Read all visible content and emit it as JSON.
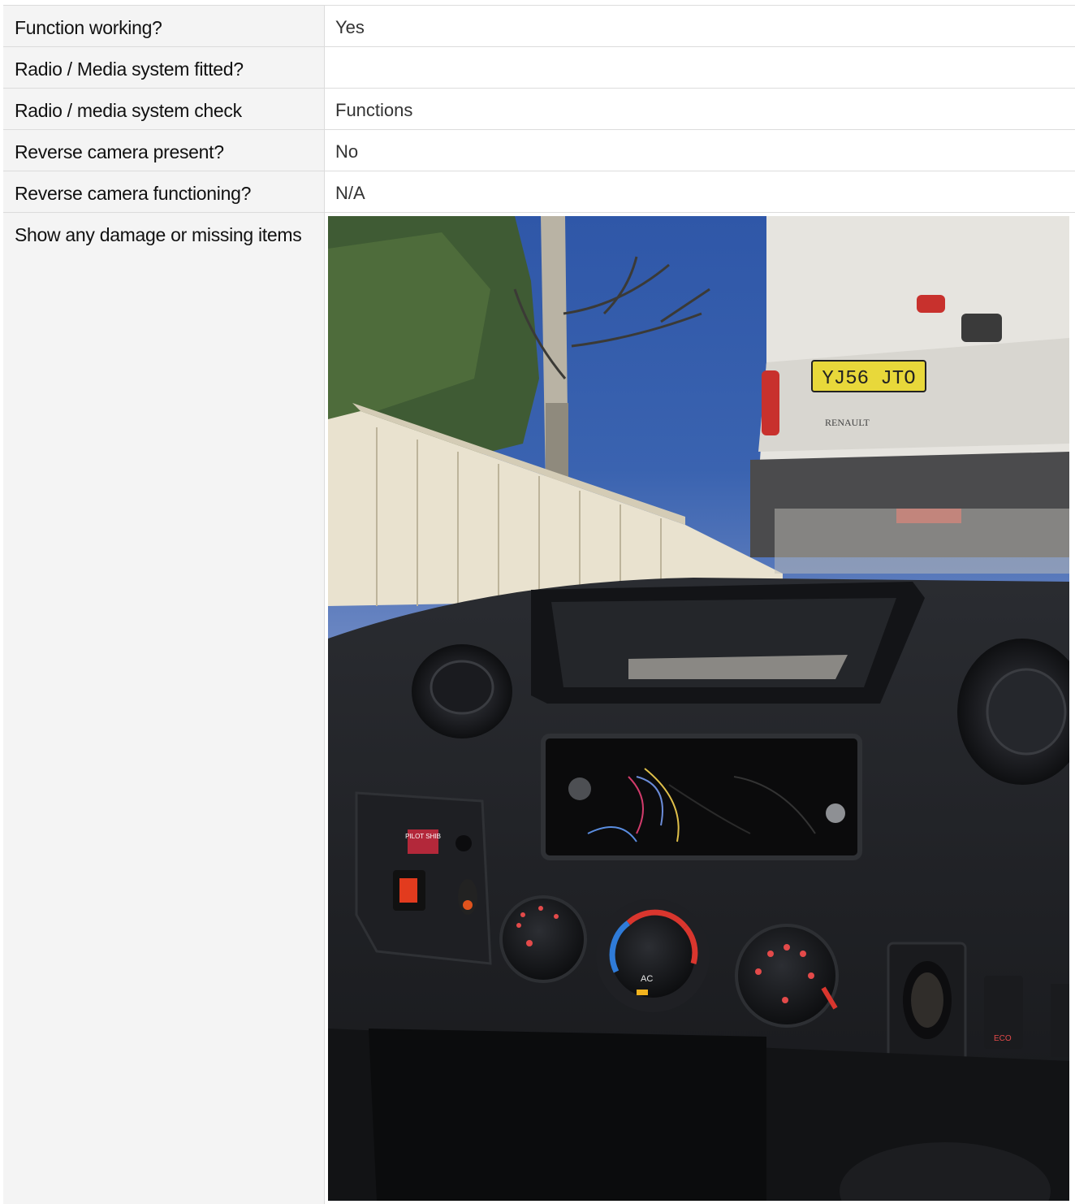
{
  "rows": [
    {
      "label": "Function working?",
      "value": "Yes"
    },
    {
      "label": "Radio / Media system fitted?",
      "value": ""
    },
    {
      "label": "Radio / media system check",
      "value": "Functions"
    },
    {
      "label": "Reverse camera present?",
      "value": "No"
    },
    {
      "label": "Reverse camera functioning?",
      "value": "N/A"
    }
  ],
  "photo_row": {
    "label": "Show any damage or missing items",
    "photo": {
      "plate": "YJ56 JTO",
      "badge": "RENAULT",
      "sticker": "PILOT SHIB",
      "ac_label": "AC",
      "eco_label": "ECO"
    }
  }
}
